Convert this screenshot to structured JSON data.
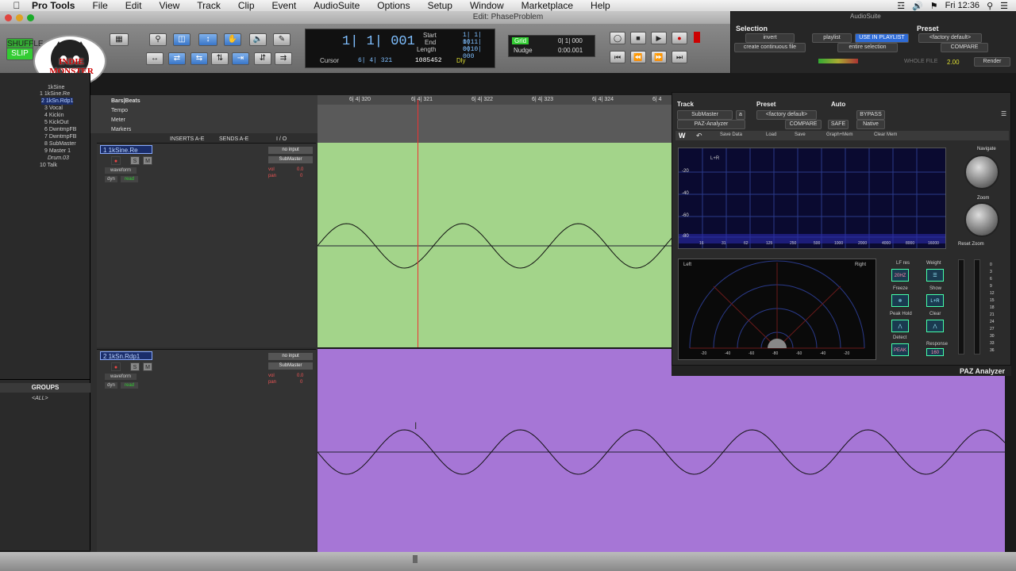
{
  "menubar": {
    "items": [
      "Pro Tools",
      "File",
      "Edit",
      "View",
      "Track",
      "Clip",
      "Event",
      "AudioSuite",
      "Options",
      "Setup",
      "Window",
      "Marketplace",
      "Help"
    ],
    "clock": "Fri 12:36"
  },
  "window": {
    "title": "Edit: PhaseProblem"
  },
  "counter": {
    "main": "1| 1| 001",
    "cursor_label": "Cursor",
    "cursor_value": "6| 4| 321",
    "start_label": "Start",
    "start_value": "1| 1| 001",
    "end_label": "End",
    "end_value": "1| 1| 001",
    "length_label": "Length",
    "length_value": "0| 0| 000",
    "sample": "1085452",
    "dly_label": "Dly"
  },
  "grid": {
    "grid_label": "Grid",
    "grid_value": "0| 1| 000",
    "nudge_label": "Nudge",
    "nudge_value": "0:00.001"
  },
  "modes": {
    "shuffle": "SHUFFLE",
    "slip": "SLIP"
  },
  "logo": {
    "text": "INDIE MONSTER"
  },
  "audiosuite": {
    "title": "AudioSuite",
    "selection_label": "Selection",
    "preset_label": "Preset",
    "invert": "invert",
    "playlist": "playlist",
    "use_in_playlist": "USE IN PLAYLIST",
    "factory_default": "<factory default>",
    "create_continuous": "create continuous file",
    "entire_selection": "entire selection",
    "compare": "COMPARE",
    "whole_file": "WHOLE FILE",
    "value": "2.00",
    "render": "Render"
  },
  "tracklist": {
    "items": [
      "1kSine",
      "1 1kSine.Re",
      "2 1kSn.Rdp1",
      "3 Vocal",
      "4 Kickin",
      "5 KickOut",
      "6 DwntmpFB",
      "7 DwntmpFB",
      "8 SubMaster",
      "9 Master 1",
      "Drum.03",
      "10 Talk"
    ]
  },
  "groups": {
    "title": "GROUPS",
    "all": "<ALL>"
  },
  "rulers": {
    "labels": [
      "Bars|Beats",
      "Tempo",
      "Meter",
      "Markers"
    ],
    "bars": [
      "6| 4| 320",
      "6| 4| 321",
      "6| 4| 322",
      "6| 4| 323",
      "6| 4| 324",
      "6| 4"
    ]
  },
  "columns": {
    "inserts": "INSERTS A-E",
    "sends": "SENDS A-E",
    "io": "I / O"
  },
  "tracks": [
    {
      "name": "1 1kSine.Re",
      "view": "waveform",
      "dyn": "dyn",
      "read": "read",
      "input": "no input",
      "output": "SubMaster",
      "vol_label": "vol",
      "vol": "0.0",
      "pan_label": "pan",
      "pan": "0"
    },
    {
      "name": "2 1kSn.Rdp1",
      "view": "waveform",
      "dyn": "dyn",
      "read": "read",
      "input": "no input",
      "output": "SubMaster",
      "vol_label": "vol",
      "vol": "0.0",
      "pan_label": "pan",
      "pan": "0"
    }
  ],
  "plugin": {
    "track_label": "Track",
    "preset_label": "Preset",
    "auto_label": "Auto",
    "track": "SubMaster",
    "insert": "a",
    "plugin_name": "PAZ-Analyzer",
    "preset": "<factory default>",
    "compare": "COMPARE",
    "safe": "SAFE",
    "bypass": "BYPASS",
    "native": "Native",
    "toolbar": [
      "Save Data",
      "Load",
      "Save",
      "Graph+Mem",
      "Clear Mem"
    ],
    "spectrum_channel": "L+R",
    "db_ticks": [
      "-20",
      "-40",
      "-60",
      "-80"
    ],
    "freq_ticks": [
      "16",
      "31",
      "62",
      "125",
      "250",
      "500",
      "1000",
      "2000",
      "4000",
      "8000",
      "16000"
    ],
    "navigate": "Navigate",
    "zoom": "Zoom",
    "reset_zoom": "Reset Zoom",
    "left": "Left",
    "right": "Right",
    "polar_ticks": [
      "-20",
      "-40",
      "-60",
      "-80",
      "-60",
      "-40",
      "-20"
    ],
    "lf_res": "LF res",
    "lf_res_value": "20HZ",
    "weight": "Weight",
    "freeze": "Freeze",
    "show": "Show",
    "show_value": "L+R",
    "peak_hold": "Peak Hold",
    "clear": "Clear",
    "detect": "Detect",
    "detect_value": "PEAK",
    "response": "Response",
    "response_value": "160",
    "footer": "PAZ Analyzer",
    "meter_ticks": [
      "0",
      "3",
      "6",
      "9",
      "12",
      "15",
      "18",
      "21",
      "24",
      "27",
      "30",
      "33",
      "36"
    ]
  }
}
